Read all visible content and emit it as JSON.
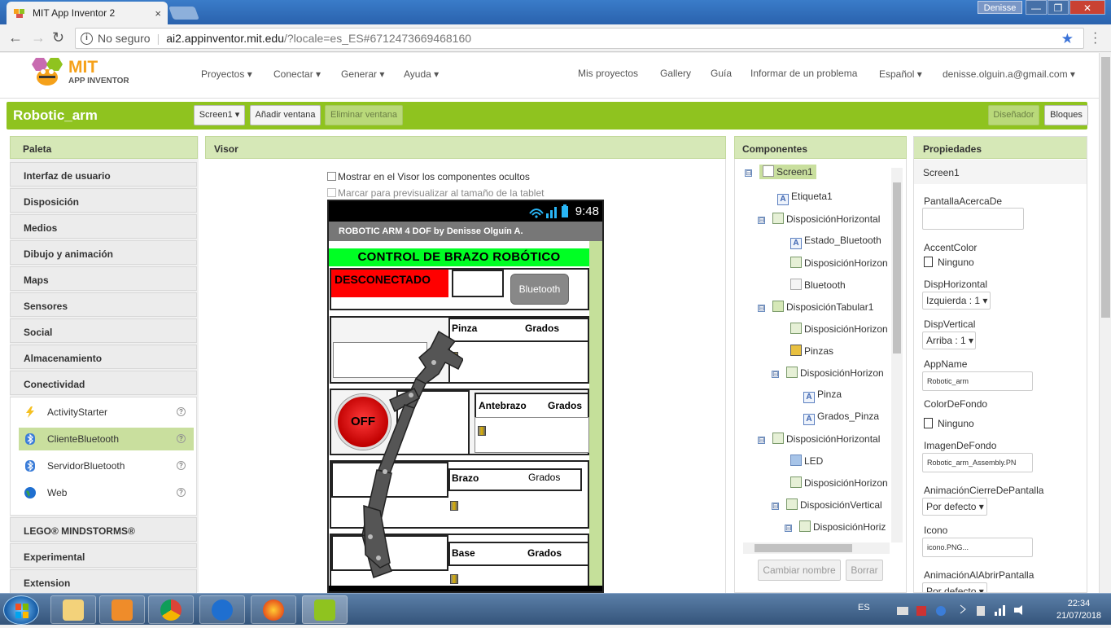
{
  "browser": {
    "tab_title": "MIT App Inventor 2",
    "tab_close": "×",
    "user_label": "Denisse",
    "minimize": "—",
    "maximize": "❐",
    "close": "✕",
    "security": "No seguro",
    "url_host": "ai2.appinventor.mit.edu",
    "url_path": "/?locale=es_ES#6712473669468160"
  },
  "nav": {
    "logo_mit": "MIT",
    "logo_sub": "APP INVENTOR",
    "menus": [
      "Proyectos ▾",
      "Conectar ▾",
      "Generar ▾",
      "Ayuda ▾"
    ],
    "right_links": [
      "Mis proyectos",
      "Gallery",
      "Guía",
      "Informar de un problema",
      "Español ▾",
      "denisse.olguin.a@gmail.com ▾"
    ]
  },
  "project": {
    "name": "Robotic_arm",
    "screen_select": "Screen1 ▾",
    "add_screen": "Añadir ventana",
    "remove_screen": "Eliminar ventana",
    "designer": "Diseñador",
    "blocks": "Bloques"
  },
  "palette": {
    "title": "Paleta",
    "categories": [
      "Interfaz de usuario",
      "Disposición",
      "Medios",
      "Dibujo y animación",
      "Maps",
      "Sensores",
      "Social",
      "Almacenamiento",
      "Conectividad"
    ],
    "items": [
      {
        "label": "ActivityStarter",
        "icon": "lightning-icon"
      },
      {
        "label": "ClienteBluetooth",
        "icon": "bluetooth-icon"
      },
      {
        "label": "ServidorBluetooth",
        "icon": "bluetooth-icon"
      },
      {
        "label": "Web",
        "icon": "globe-icon"
      }
    ],
    "help": "?",
    "bottom_categories": [
      "LEGO® MINDSTORMS®",
      "Experimental",
      "Extension"
    ]
  },
  "viewer": {
    "title": "Visor",
    "show_hidden": "Mostrar en el Visor los componentes ocultos",
    "tablet_preview": "Marcar para previsualizar al tamaño de la tablet",
    "phone": {
      "time": "9:48",
      "app_title": "ROBOTIC ARM 4 DOF by Denisse Olguín A.",
      "header": "CONTROL DE BRAZO ROBÓTICO",
      "status": "DESCONECTADO",
      "bt_button": "Bluetooth",
      "off_button": "OFF",
      "rows": [
        {
          "name": "Pinza",
          "unit": "Grados"
        },
        {
          "name": "Antebrazo",
          "unit": "Grados"
        },
        {
          "name": "Brazo",
          "unit": "Grados"
        },
        {
          "name": "Base",
          "unit": "Grados"
        }
      ]
    }
  },
  "components": {
    "title": "Componentes",
    "tree": [
      {
        "label": "Screen1",
        "toggle": "⊟",
        "icon": "screen"
      },
      {
        "label": "Etiqueta1",
        "toggle": "",
        "icon": "label"
      },
      {
        "label": "DisposiciónHorizontal",
        "toggle": "⊟",
        "icon": "hbox"
      },
      {
        "label": "Estado_Bluetooth",
        "toggle": "",
        "icon": "label"
      },
      {
        "label": "DisposiciónHorizon",
        "toggle": "",
        "icon": "hbox"
      },
      {
        "label": "Bluetooth",
        "toggle": "",
        "icon": "listpicker"
      },
      {
        "label": "DisposiciónTabular1",
        "toggle": "⊟",
        "icon": "table"
      },
      {
        "label": "DisposiciónHorizon",
        "toggle": "",
        "icon": "hbox"
      },
      {
        "label": "Pinzas",
        "toggle": "",
        "icon": "slider"
      },
      {
        "label": "DisposiciónHorizon",
        "toggle": "⊟",
        "icon": "hbox"
      },
      {
        "label": "Pinza",
        "toggle": "",
        "icon": "label"
      },
      {
        "label": "Grados_Pinza",
        "toggle": "",
        "icon": "label"
      },
      {
        "label": "DisposiciónHorizontal",
        "toggle": "⊟",
        "icon": "hbox"
      },
      {
        "label": "LED",
        "toggle": "",
        "icon": "image"
      },
      {
        "label": "DisposiciónHorizon",
        "toggle": "",
        "icon": "hbox"
      },
      {
        "label": "DisposiciónVertical",
        "toggle": "⊟",
        "icon": "vbox"
      },
      {
        "label": "DisposiciónHoriz",
        "toggle": "⊟",
        "icon": "hbox"
      }
    ],
    "rename": "Cambiar nombre",
    "delete": "Borrar"
  },
  "properties": {
    "title": "Propiedades",
    "component": "Screen1",
    "about_label": "PantallaAcercaDe",
    "about_value": "",
    "accent_label": "AccentColor",
    "accent_value": "Ninguno",
    "halign_label": "DispHorizontal",
    "halign_value": "Izquierda : 1 ▾",
    "valign_label": "DispVertical",
    "valign_value": "Arriba : 1 ▾",
    "appname_label": "AppName",
    "appname_value": "Robotic_arm",
    "bg_label": "ColorDeFondo",
    "bg_value": "Ninguno",
    "bgimg_label": "ImagenDeFondo",
    "bgimg_value": "Robotic_arm_Assembly.PN",
    "closeanim_label": "AnimaciónCierreDePantalla",
    "closeanim_value": "Por defecto ▾",
    "icon_label": "Icono",
    "icon_value": "icono.PNG...",
    "openanim_label": "AnimaciónAlAbrirPantalla",
    "openanim_value": "Por defecto ▾"
  },
  "taskbar": {
    "lang": "ES",
    "time": "22:34",
    "date": "21/07/2018"
  },
  "colors": {
    "accent_green": "#8fc31f",
    "header_green": "#00ff24",
    "status_red": "#ff0000"
  }
}
